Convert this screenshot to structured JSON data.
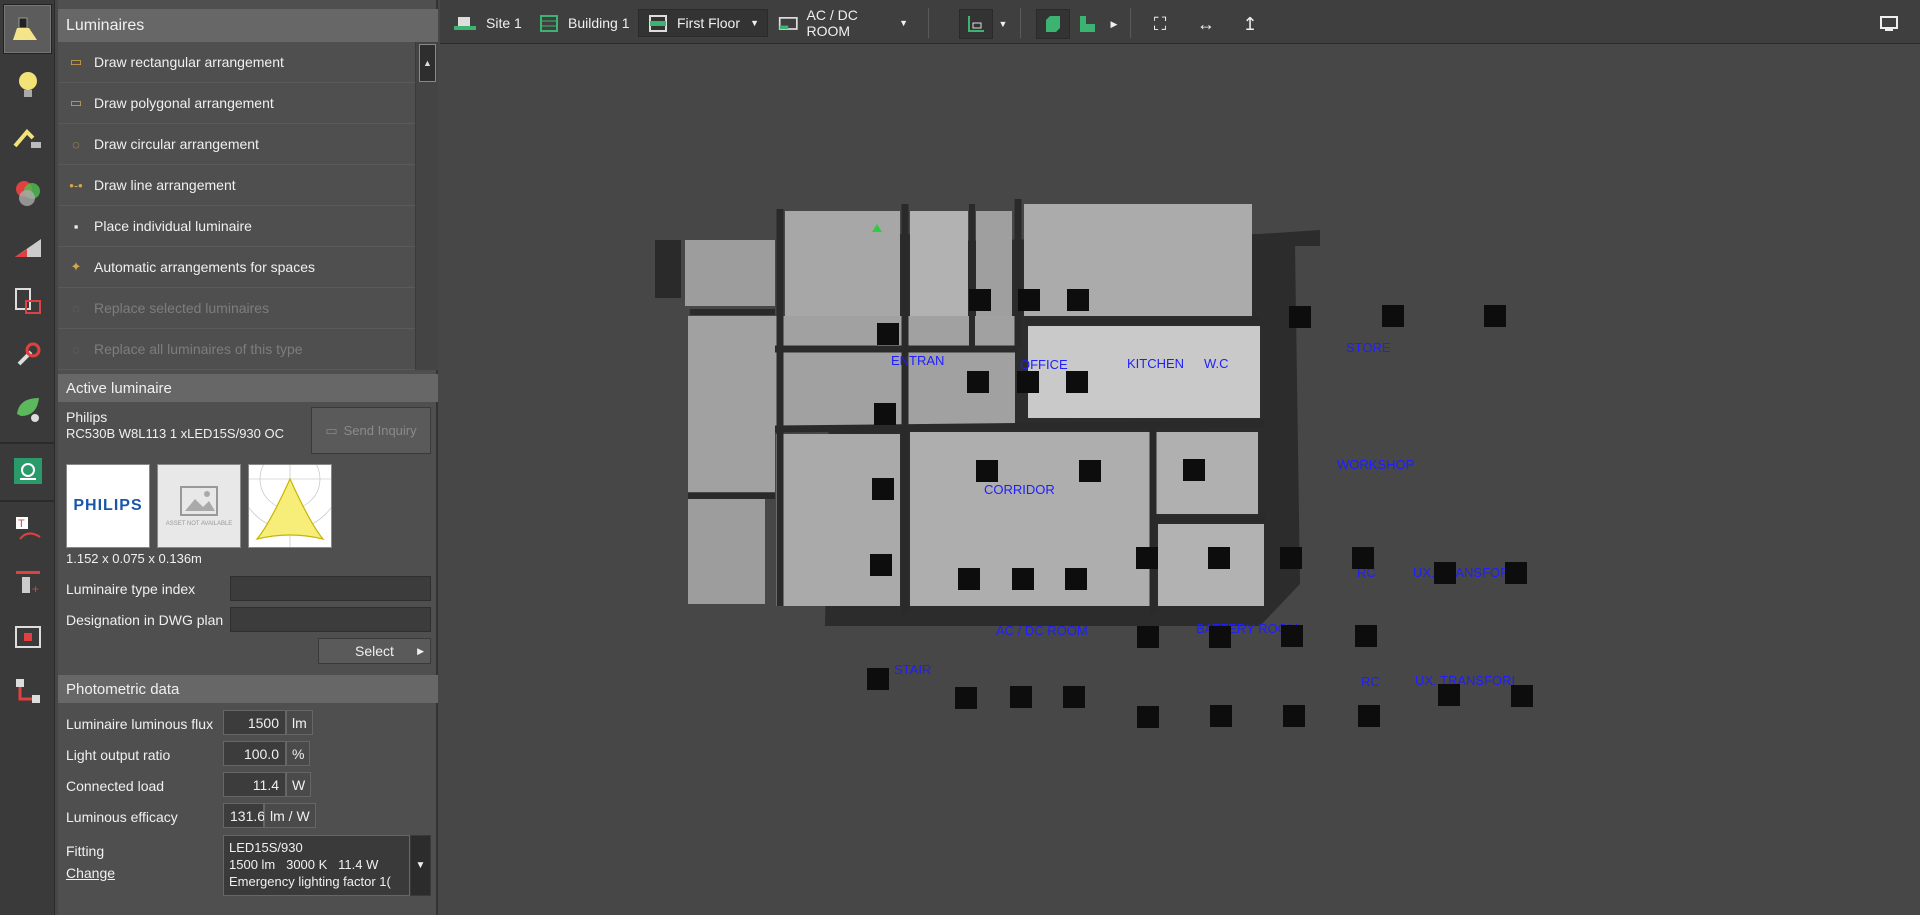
{
  "iconbar": {
    "icons": [
      "luminaire-lamp-icon",
      "bulb-icon",
      "light-scene-icon",
      "color-mix-icon",
      "daylight-icon",
      "room-elements-icon",
      "tools-icon",
      "sustainability-icon",
      "emergency-icon",
      "text-annotation-icon",
      "section-icon",
      "insert-element-icon",
      "route-icon"
    ]
  },
  "luminaires": {
    "title": "Luminaires",
    "items": [
      {
        "label": "Draw rectangular arrangement",
        "icon": "rect-arrangement-icon"
      },
      {
        "label": "Draw polygonal arrangement",
        "icon": "polygon-arrangement-icon"
      },
      {
        "label": "Draw circular arrangement",
        "icon": "circular-arrangement-icon"
      },
      {
        "label": "Draw line arrangement",
        "icon": "line-arrangement-icon"
      },
      {
        "label": "Place individual luminaire",
        "icon": "individual-luminaire-icon"
      },
      {
        "label": "Automatic arrangements for spaces",
        "icon": "magic-wand-icon"
      },
      {
        "label": "Replace selected luminaires",
        "icon": "replace-icon"
      },
      {
        "label": "Replace all luminaires of this type",
        "icon": "replace-all-icon"
      }
    ]
  },
  "active": {
    "title": "Active luminaire",
    "manufacturer": "Philips",
    "model": "RC530B W8L113 1 xLED15S/930 OC",
    "send_inquiry": "Send Inquiry",
    "logo_text": "PHILIPS",
    "asset_text": "ASSET NOT AVAILABLE",
    "dimensions": "1.152 x 0.075 x 0.136m",
    "type_index_label": "Luminaire type index",
    "type_index_value": "",
    "designation_label": "Designation in DWG plan",
    "designation_value": "",
    "select_label": "Select"
  },
  "photometric": {
    "title": "Photometric data",
    "rows": [
      {
        "label": "Luminaire luminous flux",
        "value": "1500",
        "unit": "lm"
      },
      {
        "label": "Light output ratio",
        "value": "100.0",
        "unit": "%"
      },
      {
        "label": "Connected load",
        "value": "11.4",
        "unit": "W"
      },
      {
        "label": "Luminous efficacy",
        "value": "131.6",
        "unit": "lm / W"
      }
    ],
    "fitting_label": "Fitting",
    "change_label": "Change",
    "fitting_line1": "LED15S/930",
    "fitting_line2": "1500 lm   3000 K   11.4 W",
    "fitting_line3": "Emergency lighting factor 1("
  },
  "breadcrumb": {
    "site": "Site 1",
    "building": "Building 1",
    "floor": "First Floor",
    "room": "AC / DC ROOM"
  },
  "rooms": [
    "ENTRAN",
    "OFFICE",
    "KITCHEN",
    "W.C",
    "STORE",
    "WORKSHOP",
    "CORRIDOR",
    "AC / DC ROOM",
    "BATTERY ROOM",
    "RC",
    "UX. TRANSFOR",
    "STAIR",
    "RC",
    "UX. TRANSFORI"
  ]
}
